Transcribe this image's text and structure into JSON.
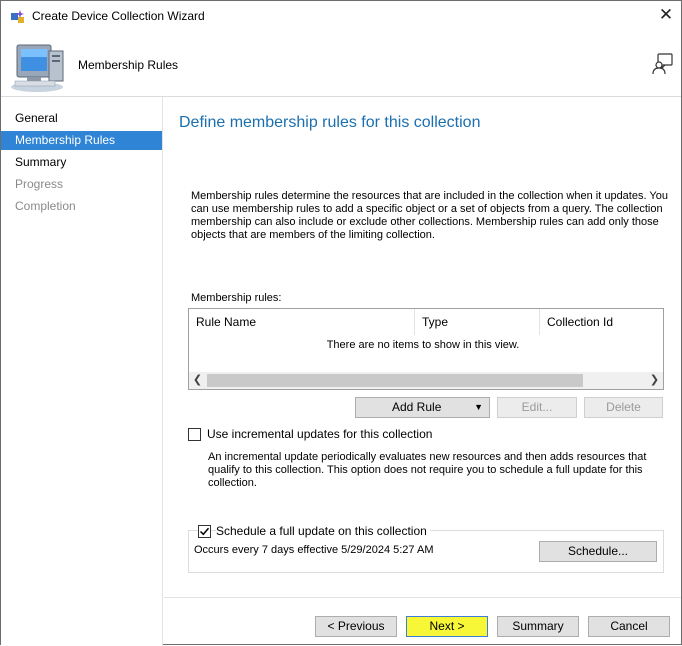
{
  "window": {
    "title": "Create Device Collection Wizard",
    "close_glyph": "✕"
  },
  "header": {
    "title": "Membership Rules",
    "icon": "computer-icon",
    "help_icon": "help-person-icon"
  },
  "sidebar": {
    "items": [
      {
        "label": "General",
        "state": "normal"
      },
      {
        "label": "Membership Rules",
        "state": "active"
      },
      {
        "label": "Summary",
        "state": "normal"
      },
      {
        "label": "Progress",
        "state": "disabled"
      },
      {
        "label": "Completion",
        "state": "disabled"
      }
    ]
  },
  "main": {
    "heading": "Define membership rules for this collection",
    "description": "Membership rules determine the resources that are included in the collection when it updates. You can use membership rules to add a specific object or a set of objects from a query. The collection membership can also include or exclude other collections. Membership rules can add only those objects that are members of the limiting collection.",
    "rules_label": "Membership rules:",
    "columns": [
      "Rule Name",
      "Type",
      "Collection Id"
    ],
    "empty_message": "There are no items to show in this view.",
    "add_rule_label": "Add Rule",
    "edit_label": "Edit...",
    "delete_label": "Delete",
    "incremental": {
      "label": "Use incremental updates for this collection",
      "checked": false,
      "description": "An incremental update periodically evaluates new resources and then adds resources that qualify to this collection. This option does not require you to schedule a full update for this collection."
    },
    "full_update": {
      "label": "Schedule a full update on this collection",
      "checked": true,
      "schedule_text": "Occurs every 7 days effective 5/29/2024 5:27 AM",
      "schedule_button": "Schedule..."
    }
  },
  "footer": {
    "previous": "< Previous",
    "next": "Next >",
    "summary": "Summary",
    "cancel": "Cancel"
  },
  "colors": {
    "accent": "#2f84d5",
    "heading": "#1a6fb0",
    "next_highlight": "#f7f737"
  }
}
